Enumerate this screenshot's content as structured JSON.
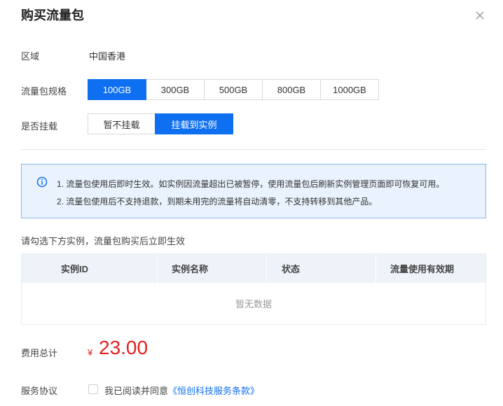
{
  "dialog": {
    "title": "购买流量包",
    "close_icon": "close-icon"
  },
  "region": {
    "label": "区域",
    "value": "中国香港"
  },
  "package_spec": {
    "label": "流量包规格",
    "options": [
      "100GB",
      "300GB",
      "500GB",
      "800GB",
      "1000GB"
    ],
    "selected": "100GB"
  },
  "mount": {
    "label": "是否挂载",
    "options": [
      "暂不挂载",
      "挂载到实例"
    ],
    "selected": "挂载到实例"
  },
  "notice": {
    "icon": "info-icon",
    "lines": [
      "1. 流量包使用后即时生效。如实例因流量超出已被暂停，使用流量包后刷新实例管理页面即可恢复可用。",
      "2. 流量包使用后不支持退款，到期未用完的流量将自动清零，不支持转移到其他产品。"
    ]
  },
  "instruction": "请勾选下方实例，流量包购买后立即生效",
  "table": {
    "columns": [
      "实例ID",
      "实例名称",
      "状态",
      "流量使用有效期"
    ],
    "empty_text": "暂无数据"
  },
  "cost": {
    "label": "费用总计",
    "currency": "¥",
    "amount": "23.00"
  },
  "agreement": {
    "label": "服务协议",
    "text": "我已阅读并同意",
    "link": "《恒创科技服务条款》",
    "checked": false
  },
  "colors": {
    "accent": "#0f6ff1",
    "price": "#e02020",
    "notice_bg": "#e9f2fd"
  }
}
